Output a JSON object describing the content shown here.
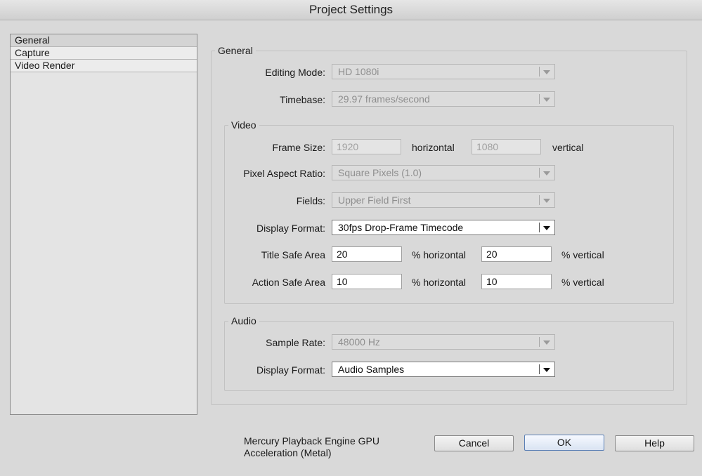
{
  "window": {
    "title": "Project Settings"
  },
  "sidebar": {
    "items": [
      {
        "label": "General",
        "selected": true
      },
      {
        "label": "Capture",
        "selected": false
      },
      {
        "label": "Video Render",
        "selected": false
      }
    ]
  },
  "general": {
    "legend": "General",
    "editing_mode": {
      "label": "Editing Mode:",
      "value": "HD 1080i",
      "enabled": false
    },
    "timebase": {
      "label": "Timebase:",
      "value": "29.97 frames/second",
      "enabled": false
    }
  },
  "video": {
    "legend": "Video",
    "frame_size": {
      "label": "Frame Size:",
      "horizontal": "1920",
      "horizontal_suffix": "horizontal",
      "vertical": "1080",
      "vertical_suffix": "vertical"
    },
    "pixel_aspect_ratio": {
      "label": "Pixel Aspect Ratio:",
      "value": "Square Pixels (1.0)",
      "enabled": false
    },
    "fields": {
      "label": "Fields:",
      "value": "Upper Field First",
      "enabled": false
    },
    "display_format": {
      "label": "Display Format:",
      "value": "30fps Drop-Frame Timecode",
      "enabled": true
    },
    "title_safe": {
      "label": "Title Safe Area",
      "horizontal": "20",
      "horizontal_suffix": "% horizontal",
      "vertical": "20",
      "vertical_suffix": "% vertical"
    },
    "action_safe": {
      "label": "Action Safe Area",
      "horizontal": "10",
      "horizontal_suffix": "% horizontal",
      "vertical": "10",
      "vertical_suffix": "% vertical"
    }
  },
  "audio": {
    "legend": "Audio",
    "sample_rate": {
      "label": "Sample Rate:",
      "value": "48000 Hz",
      "enabled": false
    },
    "display_format": {
      "label": "Display Format:",
      "value": "Audio Samples",
      "enabled": true
    }
  },
  "footer": {
    "renderer_note": "Mercury Playback Engine GPU Acceleration (Metal)",
    "cancel": "Cancel",
    "ok": "OK",
    "help": "Help"
  }
}
